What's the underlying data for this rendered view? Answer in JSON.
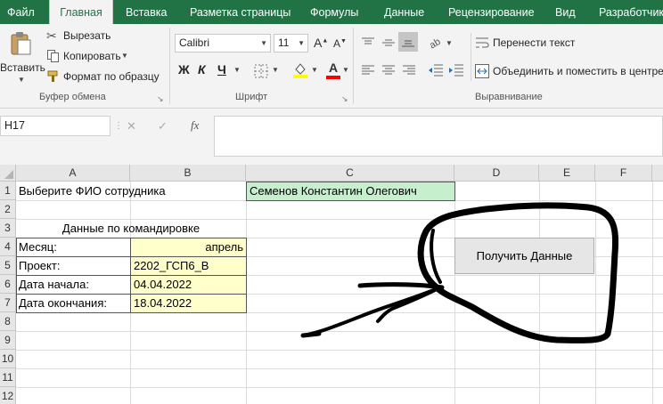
{
  "tabs": [
    "Файл",
    "Главная",
    "Вставка",
    "Разметка страницы",
    "Формулы",
    "Данные",
    "Рецензирование",
    "Вид",
    "Разработчик"
  ],
  "clipboard": {
    "paste": "Вставить",
    "cut": "Вырезать",
    "copy": "Копировать",
    "format_painter": "Формат по образцу",
    "group": "Буфер обмена"
  },
  "font": {
    "name": "Calibri",
    "size": "11",
    "bold": "Ж",
    "italic": "К",
    "underline": "Ч",
    "font_color_glyph": "А",
    "group": "Шрифт"
  },
  "alignment": {
    "wrap": "Перенести текст",
    "merge": "Объединить и поместить в центре",
    "group": "Выравнивание"
  },
  "formula_bar": {
    "name_box": "H17",
    "cancel": "✕",
    "enter": "✓",
    "fx": "fx",
    "value": ""
  },
  "columns": [
    "A",
    "B",
    "C",
    "D",
    "E",
    "F"
  ],
  "rows": [
    "1",
    "2",
    "3",
    "4",
    "5",
    "6",
    "7",
    "8",
    "9",
    "10",
    "11",
    "12"
  ],
  "cells": {
    "a1": "Выберите ФИО сотрудника",
    "c1": "Семенов Константин Олегович",
    "title3": "Данные по командировке",
    "a4": "Месяц:",
    "b4": "апрель",
    "a5": "Проект:",
    "b5": "2202_ГСП6_В",
    "a6": "Дата начала:",
    "b6": "04.04.2022",
    "a7": "Дата окончания:",
    "b7": "18.04.2022"
  },
  "button": {
    "label": "Получить Данные"
  },
  "colors": {
    "accent": "#217346",
    "input_fill": "#ffffcc",
    "selected_fill": "#c6efce",
    "button_bg": "#e6e6e6"
  }
}
